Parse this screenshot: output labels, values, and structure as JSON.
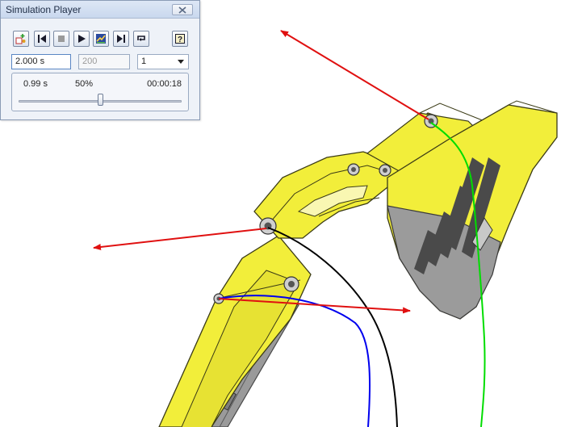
{
  "window": {
    "title": "Simulation Player"
  },
  "toolbar": {
    "buttons": [
      {
        "name": "construct-mode-button",
        "icon": "construct-icon"
      },
      {
        "name": "rewind-button",
        "icon": "skip-to-start-icon"
      },
      {
        "name": "stop-button",
        "icon": "stop-icon"
      },
      {
        "name": "play-button",
        "icon": "play-icon"
      },
      {
        "name": "play-results-button",
        "icon": "results-icon"
      },
      {
        "name": "skip-to-end-button",
        "icon": "skip-to-end-icon"
      },
      {
        "name": "loop-button",
        "icon": "loop-icon"
      },
      {
        "name": "help-button",
        "icon": "help-icon"
      }
    ]
  },
  "fields": {
    "final_time": "2.000 s",
    "images": "200",
    "filter_value": "1"
  },
  "progress": {
    "current_time": "0.99 s",
    "percent": "50%",
    "elapsed": "00:00:18",
    "slider_fraction": 0.5
  },
  "viewport": {
    "model": "excavator-arm",
    "body_color": "#f2ee3a",
    "trace_colors": [
      "#00dd00",
      "#000000",
      "#0000ee"
    ],
    "vector_color": "#ee0000"
  }
}
